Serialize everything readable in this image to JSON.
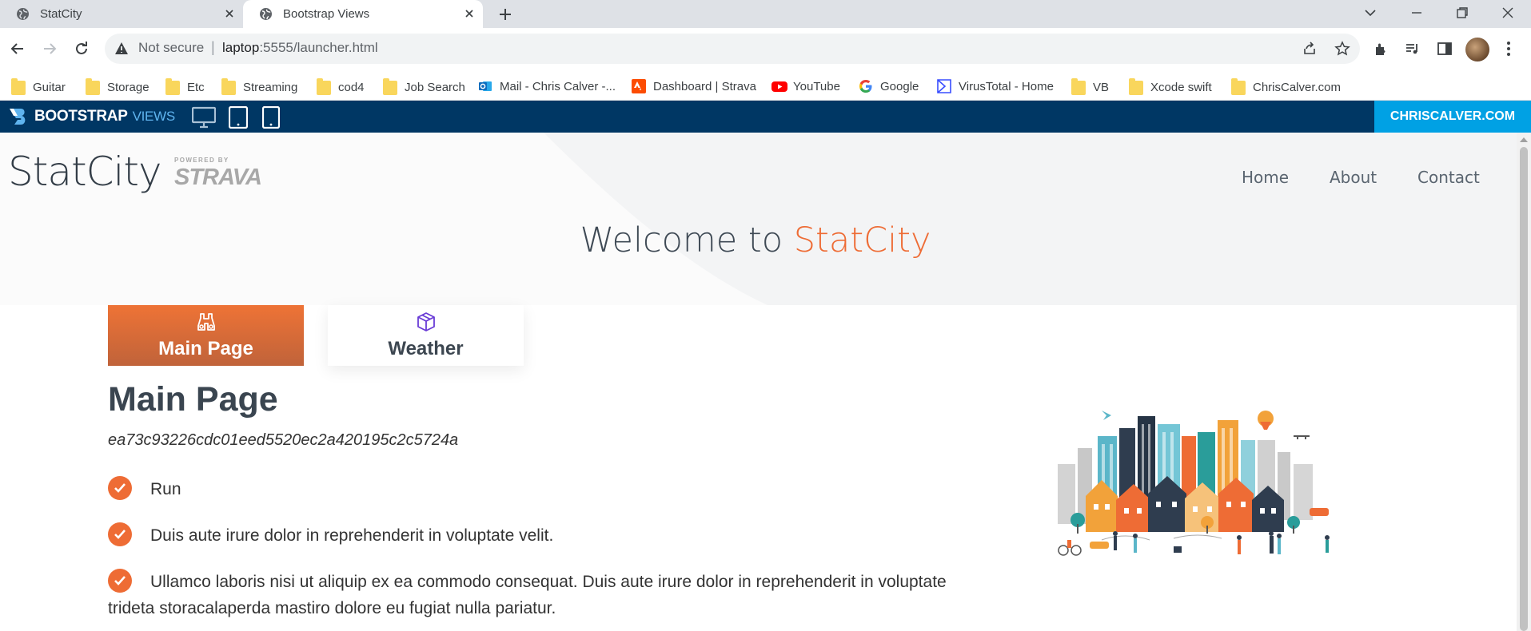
{
  "browser": {
    "tabs": [
      {
        "title": "StatCity",
        "favicon": "globe-icon",
        "active": false
      },
      {
        "title": "Bootstrap Views",
        "favicon": "globe-icon",
        "active": true
      }
    ],
    "address": {
      "security_label": "Not secure",
      "separator": "|",
      "host": "laptop",
      "path": ":5555/launcher.html"
    },
    "bookmarks": [
      {
        "label": "Guitar",
        "icon": "folder-icon"
      },
      {
        "label": "Storage",
        "icon": "folder-icon"
      },
      {
        "label": "Etc",
        "icon": "folder-icon"
      },
      {
        "label": "Streaming",
        "icon": "folder-icon"
      },
      {
        "label": "cod4",
        "icon": "folder-icon"
      },
      {
        "label": "Job Search",
        "icon": "folder-icon"
      },
      {
        "label": "Mail - Chris Calver -...",
        "icon": "outlook-icon"
      },
      {
        "label": "Dashboard | Strava",
        "icon": "strava-icon"
      },
      {
        "label": "YouTube",
        "icon": "youtube-icon"
      },
      {
        "label": "Google",
        "icon": "google-icon"
      },
      {
        "label": "VirusTotal - Home",
        "icon": "virustotal-icon"
      },
      {
        "label": "VB",
        "icon": "folder-icon"
      },
      {
        "label": "Xcode swift",
        "icon": "folder-icon"
      },
      {
        "label": "ChrisCalver.com",
        "icon": "folder-icon"
      }
    ]
  },
  "bv_bar": {
    "logo_main": "BOOTSTRAP",
    "logo_sub": "VIEWS",
    "device_icons": [
      "desktop-icon",
      "tablet-icon",
      "mobile-icon"
    ],
    "cta": "CHRISCALVER.COM",
    "colors": {
      "bar": "#003764",
      "cta": "#00a1e4"
    }
  },
  "site": {
    "brand": "StatCity",
    "powered_by": "POWERED BY",
    "powered_brand": "STRAVA",
    "nav": [
      "Home",
      "About",
      "Contact"
    ],
    "welcome_prefix": "Welcome to ",
    "welcome_accent": "StatCity",
    "accent_color": "#ee6c35",
    "tabs": [
      {
        "label": "Main Page",
        "icon": "binoculars-icon",
        "active": true
      },
      {
        "label": "Weather",
        "icon": "box-icon",
        "active": false
      }
    ],
    "section_title": "Main Page",
    "hash": "ea73c93226cdc01eed5520ec2a420195c2c5724a",
    "checklist": [
      "Run",
      "Duis aute irure dolor in reprehenderit in voluptate velit.",
      "Ullamco laboris nisi ut aliquip ex ea commodo consequat. Duis aute irure dolor in reprehenderit in voluptate trideta storacalaperda mastiro dolore eu fugiat nulla pariatur."
    ],
    "illustration": "city-illustration"
  }
}
